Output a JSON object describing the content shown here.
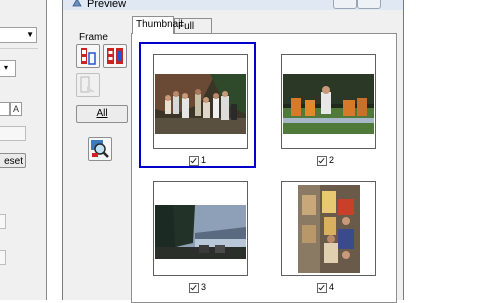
{
  "window": {
    "title": "Preview"
  },
  "sidebar": {
    "frame_label": "Frame",
    "all_button": "All"
  },
  "tabs": [
    {
      "label": "Thumbnail",
      "active": true
    },
    {
      "label": "Full Size",
      "active": false
    }
  ],
  "thumbnails": [
    {
      "number": "1",
      "checked": true,
      "selected": true
    },
    {
      "number": "2",
      "checked": true,
      "selected": false
    },
    {
      "number": "3",
      "checked": true,
      "selected": false
    },
    {
      "number": "4",
      "checked": true,
      "selected": false
    }
  ],
  "background_window": {
    "reset_button_fragment": "eset",
    "arrow_icon": "chevron-down-icon"
  },
  "colors": {
    "selection": "#0000cc",
    "window_bg": "#f0f0f0"
  }
}
